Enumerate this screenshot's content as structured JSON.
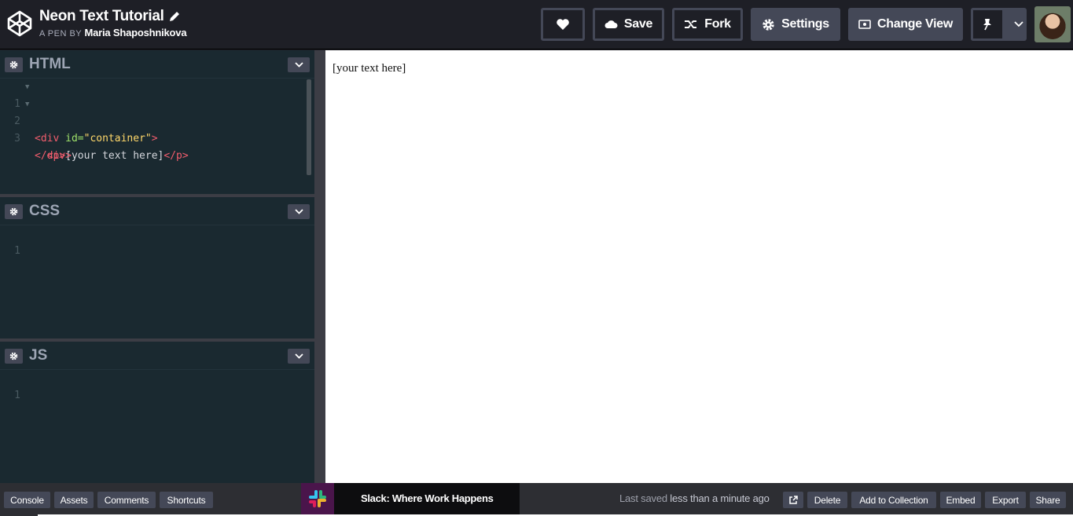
{
  "header": {
    "pen_title": "Neon Text Tutorial",
    "byline_prefix": "A PEN BY",
    "author": "Maria Shaposhnikova",
    "buttons": {
      "save": "Save",
      "fork": "Fork",
      "settings": "Settings",
      "change_view": "Change View"
    }
  },
  "editors": {
    "html": {
      "label": "HTML",
      "lines": [
        {
          "n": "1",
          "open": "<div",
          "attr": " id=",
          "str": "\"container\"",
          "close": ">"
        },
        {
          "n": "2",
          "indent": "  ",
          "open": "<p>",
          "text": "[your text here]",
          "close": "</p>"
        },
        {
          "n": "3",
          "close": "</div>"
        }
      ]
    },
    "css": {
      "label": "CSS",
      "line1": "1"
    },
    "js": {
      "label": "JS",
      "line1": "1"
    }
  },
  "preview": {
    "text": "[your text here]"
  },
  "footer": {
    "console": "Console",
    "assets": "Assets",
    "comments": "Comments",
    "shortcuts": "Shortcuts",
    "ad_text": "Slack: Where Work Happens",
    "saved_prefix": "Last saved",
    "saved_time": "less than a minute ago",
    "delete": "Delete",
    "add_to_collection": "Add to Collection",
    "embed": "Embed",
    "export": "Export",
    "share": "Share"
  },
  "colors": {
    "header_bg": "#1e1f26",
    "editor_bg": "#1a2930",
    "button_bg": "#444857",
    "tag": "#f25d6d",
    "attr": "#9fe26a",
    "string": "#ffd86a"
  }
}
